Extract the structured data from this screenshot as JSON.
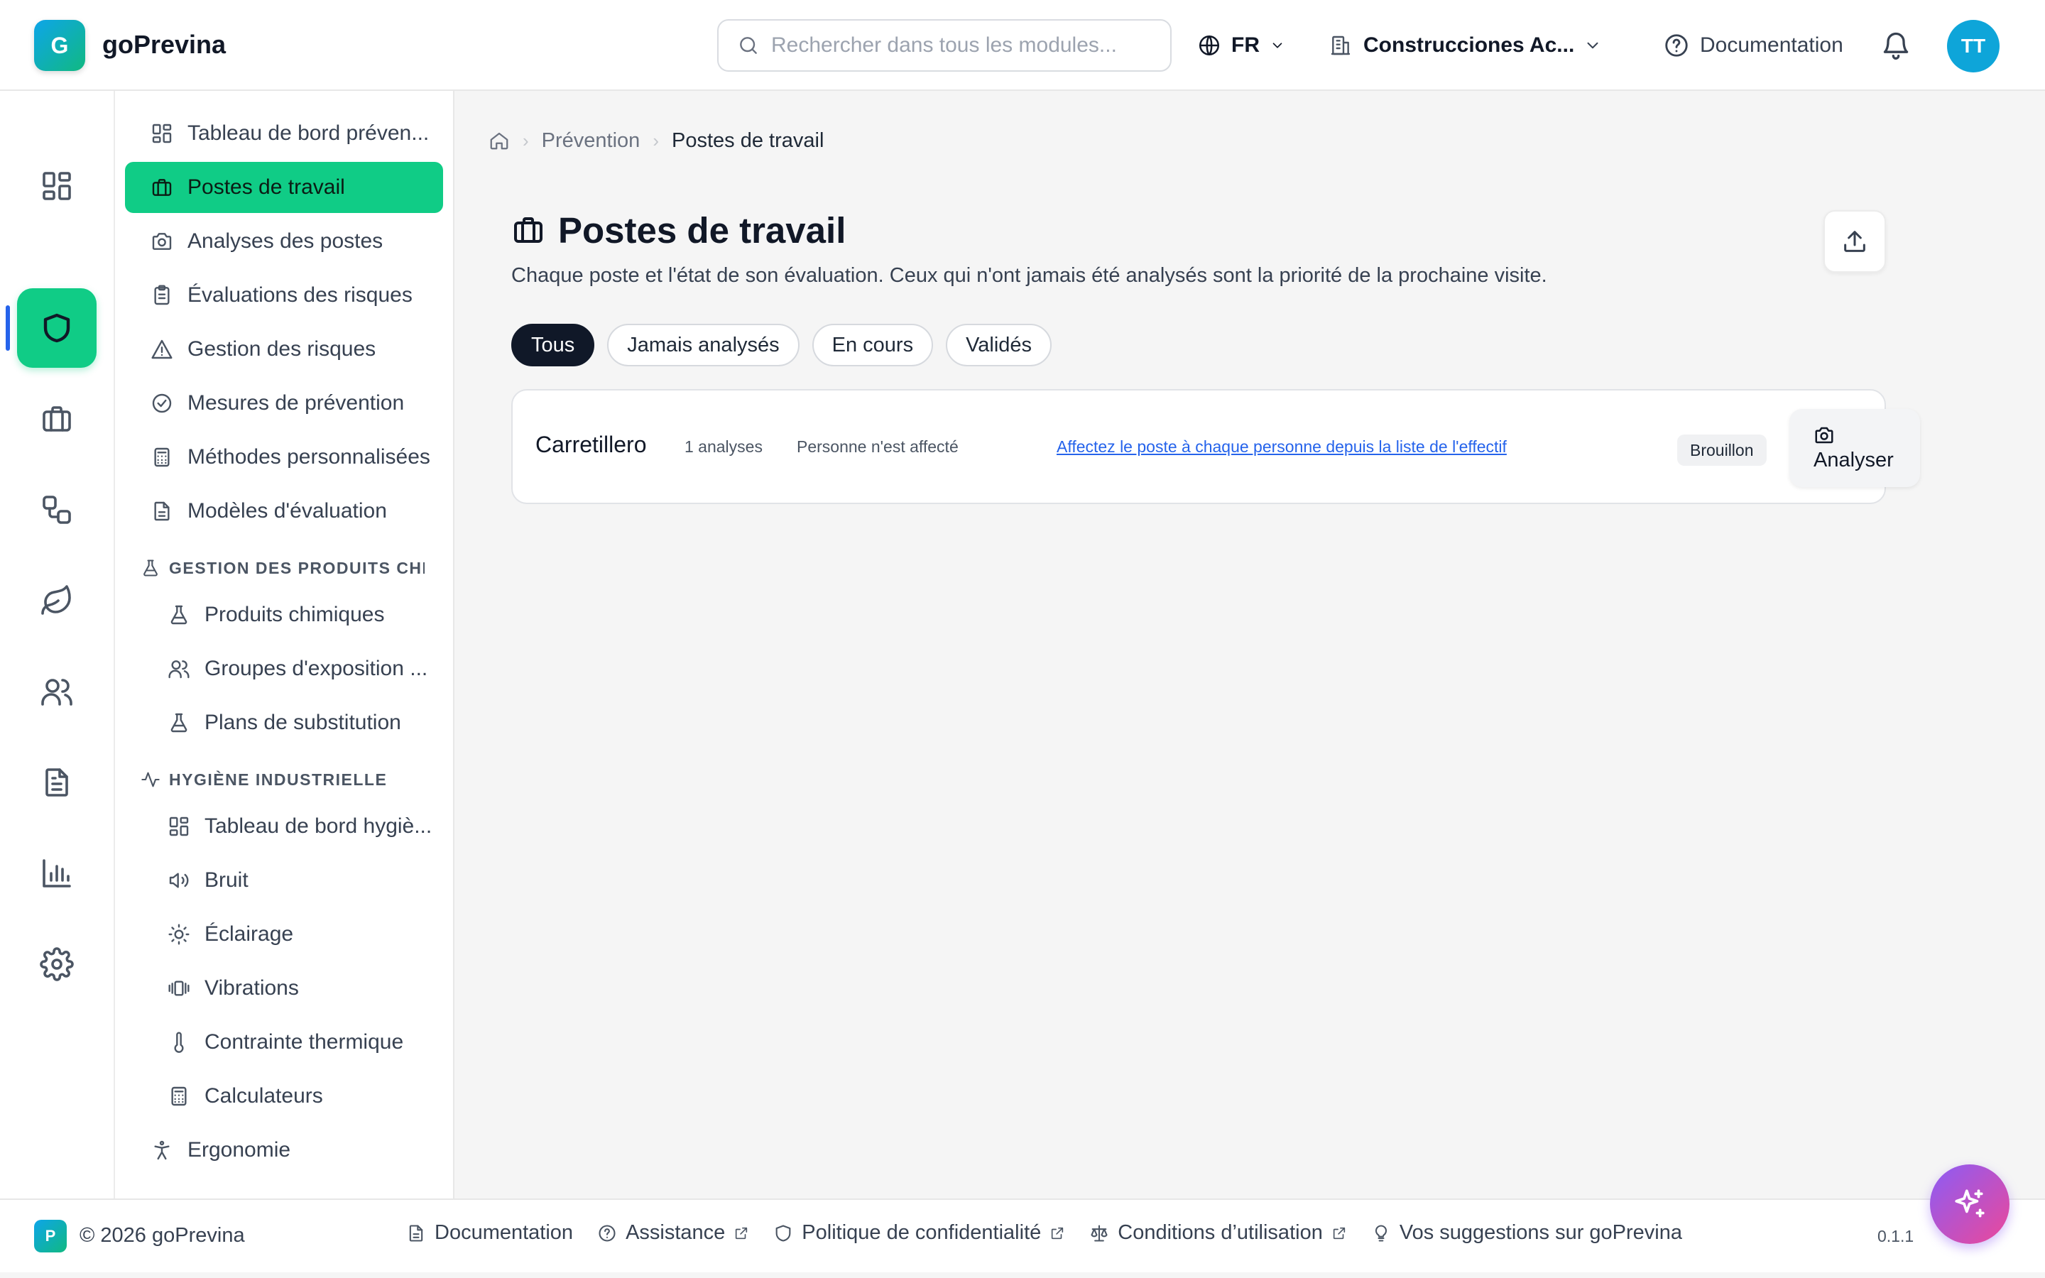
{
  "app": {
    "logo_letter": "G",
    "name": "goPrevina"
  },
  "header": {
    "search_placeholder": "Rechercher dans tous les modules...",
    "language": "FR",
    "company": "Construcciones Ac...",
    "documentation": "Documentation",
    "avatar_initials": "TT"
  },
  "rail": {
    "items": [
      {
        "icon": "dashboard-icon"
      },
      {
        "icon": "shield-icon",
        "active": true
      },
      {
        "icon": "briefcase-icon"
      },
      {
        "icon": "workflow-icon"
      },
      {
        "icon": "leaf-icon"
      },
      {
        "icon": "users-icon"
      },
      {
        "icon": "document-icon"
      },
      {
        "icon": "bar-chart-icon"
      },
      {
        "icon": "settings-icon"
      }
    ]
  },
  "sidebar": {
    "items": [
      {
        "label": "Tableau de bord préven...",
        "icon": "dashboard-icon"
      },
      {
        "label": "Postes de travail",
        "icon": "briefcase-icon",
        "active": true
      },
      {
        "label": "Analyses des postes",
        "icon": "camera-icon"
      },
      {
        "label": "Évaluations des risques",
        "icon": "clipboard-icon"
      },
      {
        "label": "Gestion des risques",
        "icon": "warning-icon"
      },
      {
        "label": "Mesures de prévention",
        "icon": "check-circle-icon"
      },
      {
        "label": "Méthodes personnalisées",
        "icon": "calculator-icon"
      },
      {
        "label": "Modèles d'évaluation",
        "icon": "file-text-icon"
      }
    ],
    "section_chemicals": {
      "title": "GESTION DES PRODUITS CHI...",
      "items": [
        {
          "label": "Produits chimiques",
          "icon": "flask-icon"
        },
        {
          "label": "Groupes d'exposition ...",
          "icon": "users-icon"
        },
        {
          "label": "Plans de substitution",
          "icon": "flask-icon"
        }
      ]
    },
    "section_hygiene": {
      "title": "HYGIÈNE INDUSTRIELLE",
      "items": [
        {
          "label": "Tableau de bord hygiè...",
          "icon": "dashboard-icon"
        },
        {
          "label": "Bruit",
          "icon": "volume-icon"
        },
        {
          "label": "Éclairage",
          "icon": "sun-icon"
        },
        {
          "label": "Vibrations",
          "icon": "vibration-icon"
        },
        {
          "label": "Contrainte thermique",
          "icon": "thermometer-icon"
        },
        {
          "label": "Calculateurs",
          "icon": "calculator-icon"
        }
      ]
    },
    "ergonomie": {
      "label": "Ergonomie",
      "icon": "accessibility-icon"
    }
  },
  "breadcrumb": {
    "parent": "Prévention",
    "current": "Postes de travail"
  },
  "page": {
    "title": "Postes de travail",
    "description": "Chaque poste et l'état de son évaluation. Ceux qui n'ont jamais été analysés sont la priorité de la prochaine visite."
  },
  "filters": [
    {
      "label": "Tous",
      "active": true
    },
    {
      "label": "Jamais analysés"
    },
    {
      "label": "En cours"
    },
    {
      "label": "Validés"
    }
  ],
  "positions": [
    {
      "name": "Carretillero",
      "analyses": "1 analyses",
      "assignment": "Personne n'est affecté",
      "assign_link": "Affectez le poste à chaque personne depuis la liste de l'effectif",
      "status": "Brouillon",
      "action": "Analyser"
    }
  ],
  "footer": {
    "logo_letter": "P",
    "copyright": "© 2026 goPrevina",
    "links": [
      {
        "label": "Documentation",
        "icon": "document-icon",
        "external": false
      },
      {
        "label": "Assistance",
        "icon": "help-circle-icon",
        "external": true
      },
      {
        "label": "Politique de confidentialité",
        "icon": "shield-icon",
        "external": true
      },
      {
        "label": "Conditions d’utilisation",
        "icon": "scale-icon",
        "external": true
      },
      {
        "label": "Vos suggestions sur goPrevina",
        "icon": "lightbulb-icon",
        "external": false
      }
    ],
    "version": "0.1.1"
  },
  "colors": {
    "accent": "#10cc86",
    "dark": "#101828",
    "link": "#2563eb",
    "indicator": "#2563eb"
  }
}
